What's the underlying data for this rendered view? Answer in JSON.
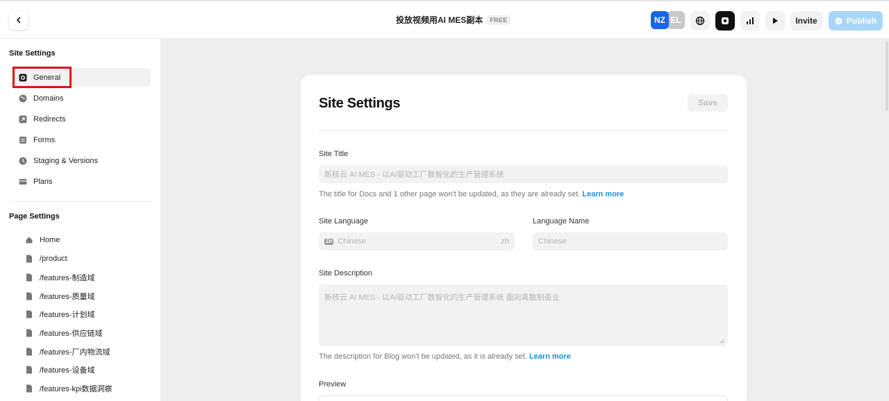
{
  "header": {
    "title": "投放视频用AI MES副本",
    "plan_badge": "FREE",
    "avatars": [
      {
        "initials": "NZ",
        "color": "#1866e6"
      },
      {
        "initials": "EL",
        "color": "#c9c9c9"
      }
    ],
    "invite_label": "Invite",
    "publish_label": "Publish",
    "publish_color": "#a9d6f7"
  },
  "sidebar": {
    "site_settings_title": "Site Settings",
    "items": [
      {
        "label": "General",
        "icon": "settings-square-icon",
        "active": true
      },
      {
        "label": "Domains",
        "icon": "globe-icon"
      },
      {
        "label": "Redirects",
        "icon": "redirect-icon"
      },
      {
        "label": "Forms",
        "icon": "forms-icon"
      },
      {
        "label": "Staging & Versions",
        "icon": "clock-icon"
      },
      {
        "label": "Plans",
        "icon": "plans-icon"
      }
    ],
    "page_settings_title": "Page Settings",
    "pages": [
      {
        "label": "Home",
        "icon": "home-icon"
      },
      {
        "label": "/product",
        "icon": "page-icon"
      },
      {
        "label": "/features-制造域",
        "icon": "page-icon"
      },
      {
        "label": "/features-质量域",
        "icon": "page-icon"
      },
      {
        "label": "/features-计划域",
        "icon": "page-icon"
      },
      {
        "label": "/features-供应链域",
        "icon": "page-icon"
      },
      {
        "label": "/features-厂内物流域",
        "icon": "page-icon"
      },
      {
        "label": "/features-设备域",
        "icon": "page-icon"
      },
      {
        "label": "/features-kpi数据洞察",
        "icon": "page-icon"
      }
    ]
  },
  "main": {
    "title": "Site Settings",
    "save_label": "Save",
    "site_title": {
      "label": "Site Title",
      "placeholder": "新核云 AI MES - 以AI驱动工厂数智化的生产管理系统",
      "help_text": "The title for Docs and 1 other page won't be updated, as they are already set.",
      "help_link": "Learn more"
    },
    "site_language": {
      "label": "Site Language",
      "tag": "ZH",
      "value": "Chinese",
      "code": "zh"
    },
    "language_name": {
      "label": "Language Name",
      "placeholder": "Chinese"
    },
    "site_description": {
      "label": "Site Description",
      "placeholder": "新核云 AI MES - 以AI驱动工厂数智化的生产管理系统 面向离散制造业",
      "help_text": "The description for Blog won't be updated, as it is already set.",
      "help_link": "Learn more"
    },
    "preview_label": "Preview"
  }
}
